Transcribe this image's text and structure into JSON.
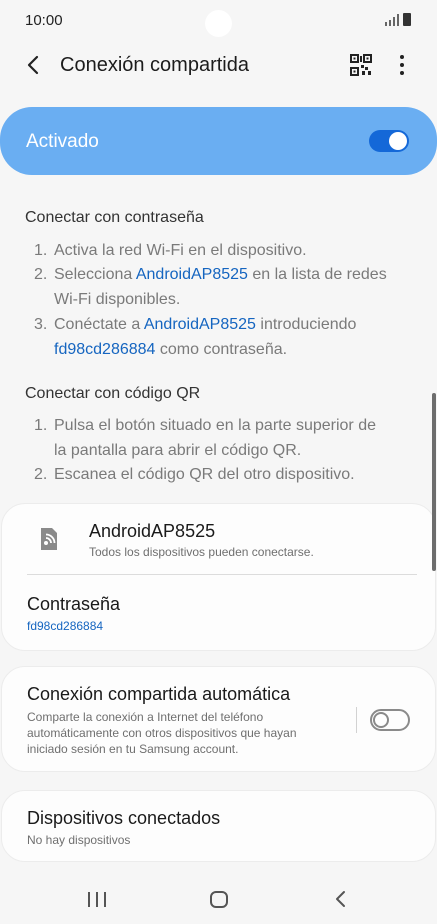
{
  "status": {
    "time": "10:00"
  },
  "header": {
    "title": "Conexión compartida"
  },
  "master": {
    "label": "Activado",
    "on": true,
    "color": "#6aaef2"
  },
  "password_section": {
    "heading": "Conectar con contraseña",
    "step1": {
      "num": "1.",
      "text": "Activa la red Wi-Fi en el dispositivo."
    },
    "step2": {
      "num": "2.",
      "pre": "Selecciona ",
      "link": "AndroidAP8525",
      "post": " en la lista de redes",
      "cont": "Wi-Fi disponibles."
    },
    "step3": {
      "num": "3.",
      "pre": "Conéctate a ",
      "link": "AndroidAP8525",
      "post": " introduciendo",
      "cont_link": "fd98cd286884",
      "cont_post": " como contraseña."
    }
  },
  "qr_section": {
    "heading": "Conectar con código QR",
    "step1": {
      "num": "1.",
      "text": "Pulsa el botón situado en la parte superior de",
      "cont": "la pantalla para abrir el código QR."
    },
    "step2": {
      "num": "2.",
      "text": "Escanea el código QR del otro dispositivo."
    }
  },
  "network": {
    "name": "AndroidAP8525",
    "subtitle": "Todos los dispositivos pueden conectarse.",
    "password_label": "Contraseña",
    "password_value": "fd98cd286884"
  },
  "auto_hotspot": {
    "title": "Conexión compartida automática",
    "line1": "Comparte la conexión a Internet del teléfono",
    "line2": "automáticamente con otros dispositivos que hayan",
    "line3": "iniciado sesión en tu Samsung account.",
    "on": false
  },
  "connected": {
    "title": "Dispositivos conectados",
    "subtitle": "No hay dispositivos"
  },
  "colors": {
    "accent": "#1565c0",
    "toggle_on": "#1468d8"
  }
}
